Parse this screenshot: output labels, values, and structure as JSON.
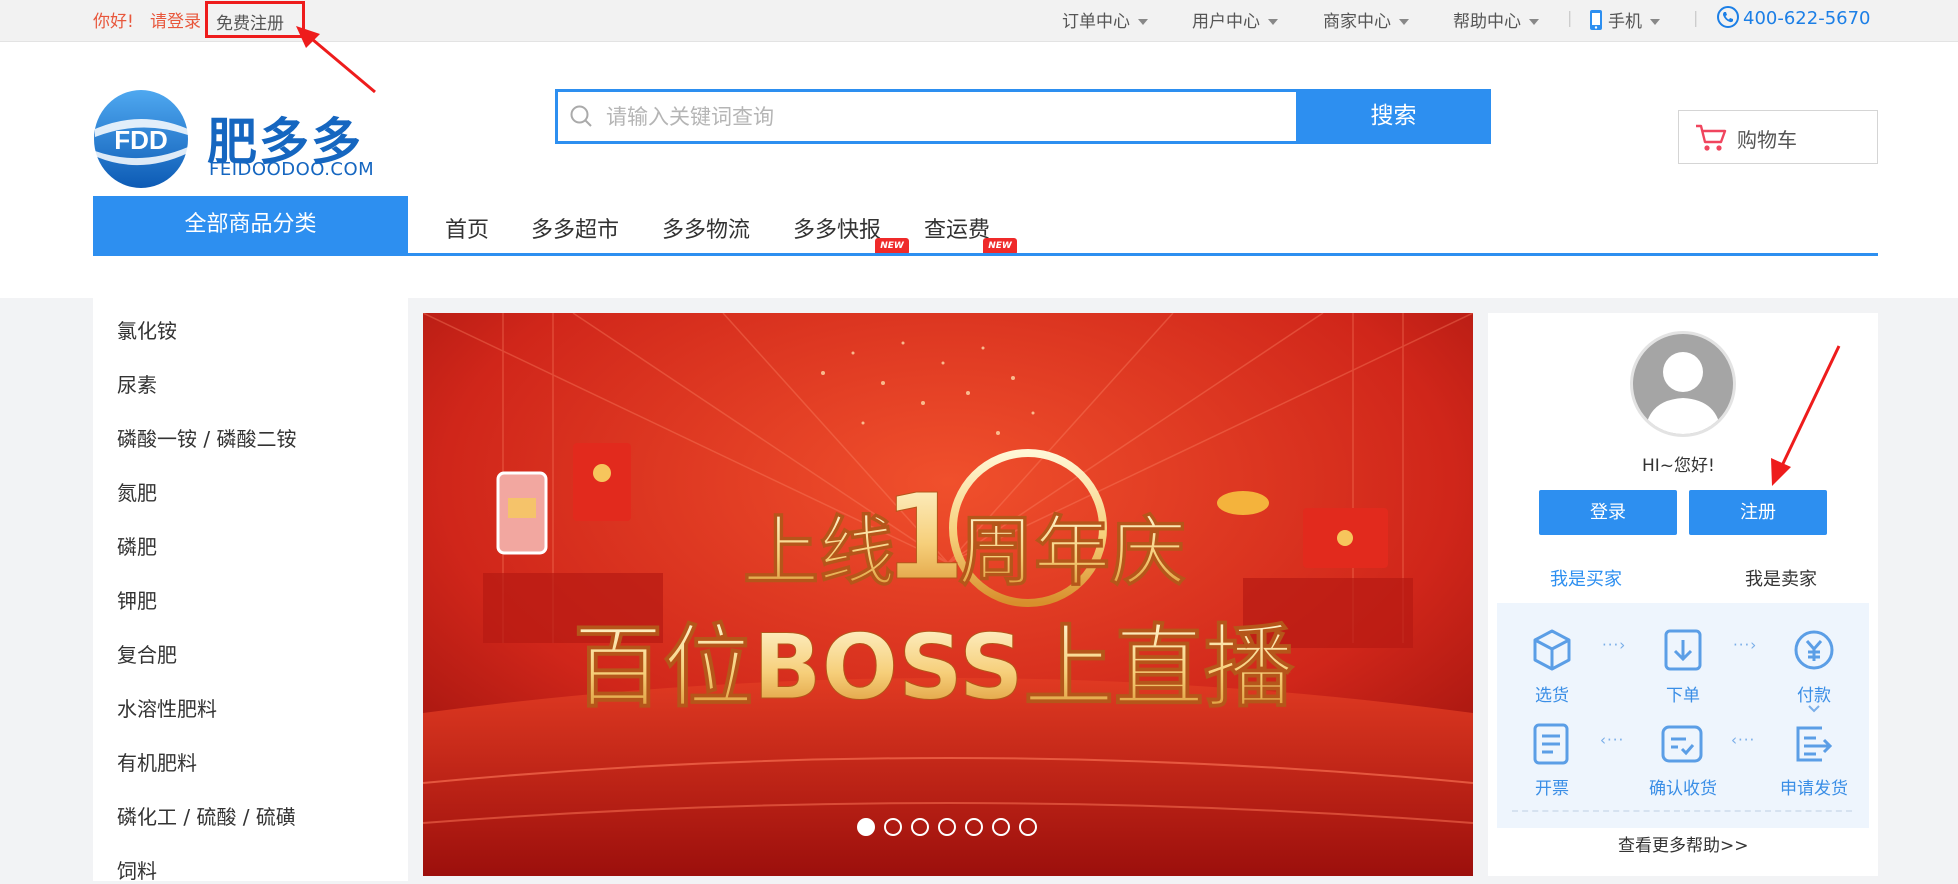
{
  "topbar": {
    "greeting": "你好!",
    "login": "请登录",
    "register": "免费注册",
    "menus": [
      "订单中心",
      "用户中心",
      "商家中心",
      "帮助中心"
    ],
    "mobile": "手机",
    "hotline": "400-622-5670"
  },
  "header": {
    "logo_abbr": "FDD",
    "logo_cn": "肥多多",
    "logo_en": "FEIDOODOO.COM",
    "search_placeholder": "请输入关键词查询",
    "search_button": "搜索",
    "cart": "购物车"
  },
  "nav": {
    "all_categories": "全部商品分类",
    "items": [
      "首页",
      "多多超市",
      "多多物流",
      "多多快报",
      "查运费"
    ],
    "badge": "NEW"
  },
  "categories": [
    "氯化铵",
    "尿素",
    "磷酸一铵 / 磷酸二铵",
    "氮肥",
    "磷肥",
    "钾肥",
    "复合肥",
    "水溶性肥料",
    "有机肥料",
    "磷化工 / 硫酸 / 硫磺",
    "饲料"
  ],
  "banner": {
    "line1_a": "上线",
    "line1_num": "1",
    "line1_b": "周年庆",
    "line2": "百位BOSS上直播",
    "slide_count": 7,
    "active_slide": 1
  },
  "panel": {
    "greeting": "HI~您好!",
    "login_button": "登录",
    "register_button": "注册",
    "tab_buyer": "我是买家",
    "tab_seller": "我是卖家",
    "steps": [
      "选货",
      "下单",
      "付款",
      "开票",
      "确认收货",
      "申请发货"
    ],
    "help_link": "查看更多帮助>>"
  },
  "colors": {
    "brand_blue": "#2d8ff0",
    "annotation_red": "#ee1c1c",
    "greeting_orange": "#e8573c"
  }
}
